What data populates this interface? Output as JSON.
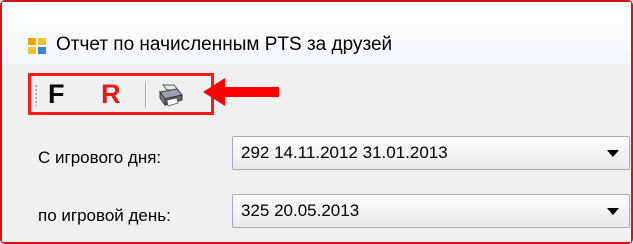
{
  "window": {
    "title": "Отчет по начисленным PTS за друзей",
    "icon": "app-window-icon"
  },
  "toolbar": {
    "f_label": "F",
    "r_label": "R",
    "print_icon": "printer-icon",
    "highlight_color": "#ff1a1a",
    "r_color": "#e8191c"
  },
  "annotation": {
    "arrow_icon": "left-arrow-icon",
    "color": "#ff0000"
  },
  "form": {
    "from_day": {
      "label": "С игрового дня:",
      "value": "292 14.11.2012 31.01.2013"
    },
    "to_day": {
      "label": "по игровой день:",
      "value": "325 20.05.2013"
    }
  }
}
